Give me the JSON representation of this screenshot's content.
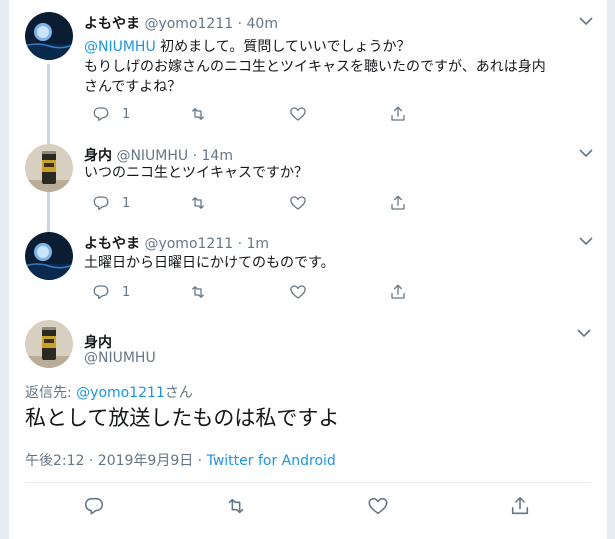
{
  "tweets": [
    {
      "name": "よもやま",
      "handle": "@yomo1211",
      "dot": "·",
      "time": "40m",
      "mention": "@NIUMHU",
      "text": " 初めまして。質問していいでしょうか？",
      "text2": "もりしげのお嫁さんのニコ生とツイキャスを聴いたのですが、あれは身内",
      "text3": "さんですよね？",
      "reply_count": "1"
    },
    {
      "name": "身内",
      "handle": "@NIUMHU",
      "dot": "·",
      "time": "14m",
      "text": "いつのニコ生とツイキャスですか？",
      "reply_count": "1"
    },
    {
      "name": "よもやま",
      "handle": "@yomo1211",
      "dot": "·",
      "time": "1m",
      "text": "土曜日から日曜日にかけてのものです。",
      "reply_count": "1"
    }
  ],
  "focus": {
    "name": "身内",
    "handle": "@NIUMHU",
    "reply_prefix": "返信先: ",
    "reply_mention": "@yomo1211",
    "reply_suffix": "さん",
    "text": "私として放送したものは私ですよ",
    "time": "午後2:12 · 2019年9月9日 · ",
    "source": "Twitter for Android"
  },
  "icons": [
    "reply-icon",
    "retweet-icon",
    "like-icon",
    "share-icon",
    "chevron-down-icon"
  ],
  "colors": {
    "link": "#1b95e0",
    "secondary": "#657786",
    "line": "#ccd6dd",
    "bg": "#e6ecf0"
  }
}
